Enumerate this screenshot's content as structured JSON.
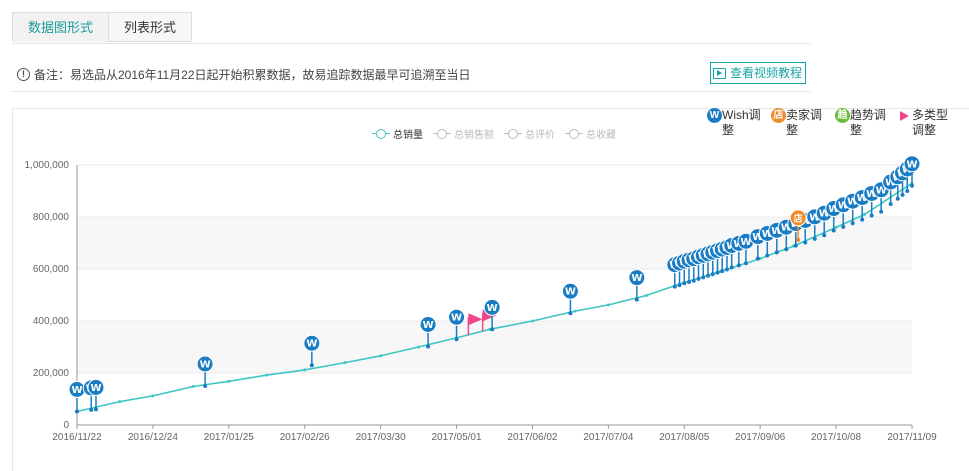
{
  "tabs": [
    "数据图形式",
    "列表形式"
  ],
  "note": {
    "icon": "info-icon",
    "text": "备注：易选品从2016年11月22日起开始积累数据，故易追踪数据最早可追溯至当日"
  },
  "video_button": {
    "icon": "video-icon",
    "label": "查看视频教程"
  },
  "legend": [
    {
      "label": "总销量",
      "active": true
    },
    {
      "label": "总销售额",
      "active": false
    },
    {
      "label": "总评价",
      "active": false
    },
    {
      "label": "总收藏",
      "active": false
    }
  ],
  "adjust_legend": [
    {
      "badge": "W",
      "label": "Wish调整",
      "color": "#1a7dc4"
    },
    {
      "badge": "店",
      "label": "卖家调整",
      "color": "#f08b2c"
    },
    {
      "badge": "趋",
      "label": "趋势调整",
      "color": "#6cbd3a"
    },
    {
      "badge": "",
      "label": "多类型调整",
      "color": "#f0478a"
    }
  ],
  "colors": {
    "line": "#3ec7c2",
    "wish": "#1a7dc4",
    "seller": "#f08b2c",
    "flag": "#f0478a",
    "accent": "#1a9b9b"
  },
  "chart_data": {
    "type": "line",
    "series": [
      {
        "name": "总销量",
        "points": [
          [
            "2016-11-22",
            52000
          ],
          [
            "2016-12-10",
            90000
          ],
          [
            "2016-12-24",
            112000
          ],
          [
            "2017-01-10",
            148000
          ],
          [
            "2017-01-25",
            168000
          ],
          [
            "2017-02-10",
            192000
          ],
          [
            "2017-02-26",
            212000
          ],
          [
            "2017-03-15",
            240000
          ],
          [
            "2017-03-30",
            266000
          ],
          [
            "2017-04-15",
            300000
          ],
          [
            "2017-05-01",
            335000
          ],
          [
            "2017-05-15",
            368000
          ],
          [
            "2017-06-02",
            400000
          ],
          [
            "2017-06-20",
            438000
          ],
          [
            "2017-07-04",
            462000
          ],
          [
            "2017-07-20",
            498000
          ],
          [
            "2017-08-05",
            548000
          ],
          [
            "2017-08-20",
            590000
          ],
          [
            "2017-09-06",
            640000
          ],
          [
            "2017-09-20",
            688000
          ],
          [
            "2017-10-08",
            760000
          ],
          [
            "2017-10-20",
            810000
          ],
          [
            "2017-11-09",
            930000
          ]
        ]
      }
    ],
    "xticks": [
      "2016/11/22",
      "2016/12/24",
      "2017/01/25",
      "2017/02/26",
      "2017/03/30",
      "2017/05/01",
      "2017/06/02",
      "2017/07/04",
      "2017/08/05",
      "2017/09/06",
      "2017/10/08",
      "2017/11/09"
    ],
    "yticks": [
      "0",
      "200,000",
      "400,000",
      "600,000",
      "800,000",
      "1,000,000"
    ],
    "ylim": [
      0,
      1000000
    ],
    "xlim": [
      "2016-11-22",
      "2017-11-09"
    ],
    "markers": [
      {
        "type": "W",
        "date": "2016-11-22",
        "value": 52000
      },
      {
        "type": "W",
        "date": "2016-11-28",
        "value": 58000
      },
      {
        "type": "W",
        "date": "2016-11-30",
        "value": 60000
      },
      {
        "type": "W",
        "date": "2017-01-15",
        "value": 150000
      },
      {
        "type": "W",
        "date": "2017-03-01",
        "value": 230000
      },
      {
        "type": "W",
        "date": "2017-04-19",
        "value": 302000
      },
      {
        "type": "W",
        "date": "2017-05-01",
        "value": 330000
      },
      {
        "type": "flag",
        "date": "2017-05-06",
        "value": 345000
      },
      {
        "type": "flag",
        "date": "2017-05-12",
        "value": 360000
      },
      {
        "type": "W",
        "date": "2017-05-16",
        "value": 368000
      },
      {
        "type": "W",
        "date": "2017-06-18",
        "value": 430000
      },
      {
        "type": "W",
        "date": "2017-07-16",
        "value": 482000
      },
      {
        "type": "W",
        "date": "2017-08-01",
        "value": 532000
      },
      {
        "type": "W",
        "date": "2017-08-03",
        "value": 538000
      },
      {
        "type": "W",
        "date": "2017-08-05",
        "value": 545000
      },
      {
        "type": "W",
        "date": "2017-08-07",
        "value": 550000
      },
      {
        "type": "W",
        "date": "2017-08-09",
        "value": 555000
      },
      {
        "type": "W",
        "date": "2017-08-11",
        "value": 562000
      },
      {
        "type": "W",
        "date": "2017-08-13",
        "value": 568000
      },
      {
        "type": "W",
        "date": "2017-08-15",
        "value": 574000
      },
      {
        "type": "W",
        "date": "2017-08-17",
        "value": 580000
      },
      {
        "type": "W",
        "date": "2017-08-19",
        "value": 586000
      },
      {
        "type": "W",
        "date": "2017-08-21",
        "value": 592000
      },
      {
        "type": "W",
        "date": "2017-08-23",
        "value": 598000
      },
      {
        "type": "W",
        "date": "2017-08-25",
        "value": 606000
      },
      {
        "type": "W",
        "date": "2017-08-28",
        "value": 614000
      },
      {
        "type": "W",
        "date": "2017-08-31",
        "value": 622000
      },
      {
        "type": "W",
        "date": "2017-09-05",
        "value": 640000
      },
      {
        "type": "W",
        "date": "2017-09-09",
        "value": 652000
      },
      {
        "type": "W",
        "date": "2017-09-13",
        "value": 664000
      },
      {
        "type": "W",
        "date": "2017-09-17",
        "value": 676000
      },
      {
        "type": "W",
        "date": "2017-09-21",
        "value": 690000
      },
      {
        "type": "W",
        "date": "2017-09-25",
        "value": 702000
      },
      {
        "type": "seller",
        "date": "2017-09-22",
        "value": 712000
      },
      {
        "type": "W",
        "date": "2017-09-29",
        "value": 716000
      },
      {
        "type": "W",
        "date": "2017-10-03",
        "value": 730000
      },
      {
        "type": "W",
        "date": "2017-10-07",
        "value": 748000
      },
      {
        "type": "W",
        "date": "2017-10-11",
        "value": 762000
      },
      {
        "type": "W",
        "date": "2017-10-15",
        "value": 776000
      },
      {
        "type": "W",
        "date": "2017-10-19",
        "value": 790000
      },
      {
        "type": "W",
        "date": "2017-10-23",
        "value": 806000
      },
      {
        "type": "W",
        "date": "2017-10-27",
        "value": 820000
      },
      {
        "type": "W",
        "date": "2017-10-31",
        "value": 850000
      },
      {
        "type": "W",
        "date": "2017-11-03",
        "value": 870000
      },
      {
        "type": "W",
        "date": "2017-11-05",
        "value": 885000
      },
      {
        "type": "W",
        "date": "2017-11-07",
        "value": 900000
      },
      {
        "type": "W",
        "date": "2017-11-09",
        "value": 920000
      }
    ]
  }
}
